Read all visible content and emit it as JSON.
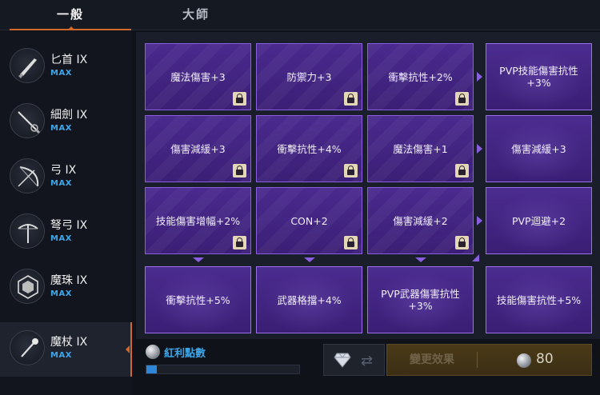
{
  "tabs": [
    {
      "label": "一般"
    },
    {
      "label": "大師"
    }
  ],
  "weapons": [
    {
      "name": "匕首 IX",
      "level": "MAX",
      "icon": "dagger-icon"
    },
    {
      "name": "細劍 IX",
      "level": "MAX",
      "icon": "rapier-icon"
    },
    {
      "name": "弓 IX",
      "level": "MAX",
      "icon": "bow-icon"
    },
    {
      "name": "弩弓 IX",
      "level": "MAX",
      "icon": "crossbow-icon"
    },
    {
      "name": "魔珠 IX",
      "level": "MAX",
      "icon": "orb-icon"
    },
    {
      "name": "魔杖 IX",
      "level": "MAX",
      "icon": "wand-icon"
    }
  ],
  "grid": {
    "rows": [
      [
        {
          "label": "魔法傷害+3",
          "locked": true
        },
        {
          "label": "防禦力+3",
          "locked": true
        },
        {
          "label": "衝擊抗性+2%",
          "locked": true
        },
        {
          "label": "PVP技能傷害抗性+3%",
          "locked": false
        }
      ],
      [
        {
          "label": "傷害減緩+3",
          "locked": true
        },
        {
          "label": "衝擊抗性+4%",
          "locked": true
        },
        {
          "label": "魔法傷害+1",
          "locked": true
        },
        {
          "label": "傷害減緩+3",
          "locked": false
        }
      ],
      [
        {
          "label": "技能傷害增幅+2%",
          "locked": true
        },
        {
          "label": "CON+2",
          "locked": true
        },
        {
          "label": "傷害減緩+2",
          "locked": true
        },
        {
          "label": "PVP迴避+2",
          "locked": false
        }
      ],
      [
        {
          "label": "衝擊抗性+5%",
          "locked": false
        },
        {
          "label": "武器格擋+4%",
          "locked": false
        },
        {
          "label": "PVP武器傷害抗性+3%",
          "locked": false
        },
        {
          "label": "技能傷害抗性+5%",
          "locked": false
        }
      ]
    ]
  },
  "bonus": {
    "label": "紅利點數",
    "progress": 0.07
  },
  "change_button": {
    "label": "變更效果",
    "cost": "80"
  },
  "colors": {
    "accent": "#d2692a",
    "max_blue": "#3fa6e8",
    "cell_border": "#8a5ee0",
    "cell_fill": "#3b1f76"
  }
}
